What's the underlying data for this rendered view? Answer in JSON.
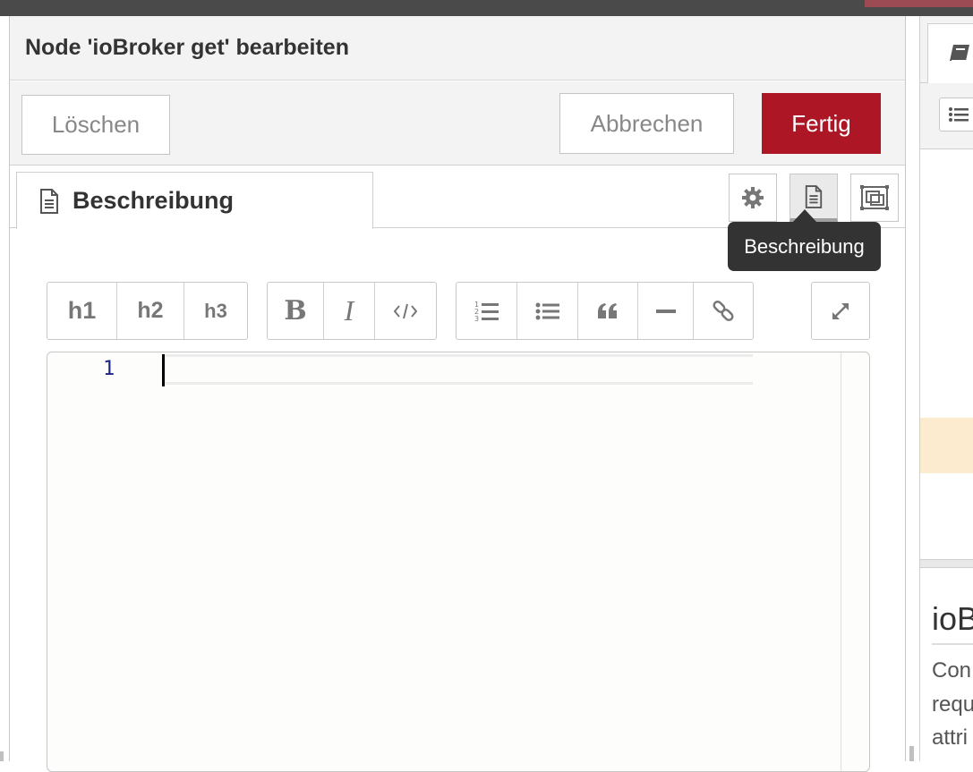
{
  "editor": {
    "title": "Node 'ioBroker get' bearbeiten",
    "buttons": {
      "delete": "Löschen",
      "cancel": "Abbrechen",
      "done": "Fertig"
    },
    "tab": {
      "label": "Beschreibung",
      "icon": "file-text-icon"
    },
    "tab_buttons": [
      {
        "name": "properties",
        "icon": "gear-icon"
      },
      {
        "name": "description",
        "icon": "file-text-icon",
        "active": true
      },
      {
        "name": "appearance",
        "icon": "layout-icon"
      }
    ],
    "tooltip": "Beschreibung",
    "markdown_toolbar": {
      "headings": [
        "h1",
        "h2",
        "h3"
      ],
      "format": [
        "bold-icon",
        "italic-icon",
        "code-icon"
      ],
      "blocks": [
        "ordered-list-icon",
        "unordered-list-icon",
        "quote-icon",
        "horizontal-rule-icon",
        "link-icon"
      ],
      "expand": "expand-icon"
    },
    "code_editor": {
      "line_numbers": [
        "1"
      ],
      "content": ""
    }
  },
  "sidebar": {
    "tab_icon": "book-icon",
    "tool_icon": "list-icon",
    "help_title": "ioB",
    "help_lines": [
      "Con",
      "requ",
      "attri"
    ]
  },
  "colors": {
    "primary": "#ad1625",
    "topbar": "#4a4a4a",
    "highlight": "#fdebd0"
  }
}
